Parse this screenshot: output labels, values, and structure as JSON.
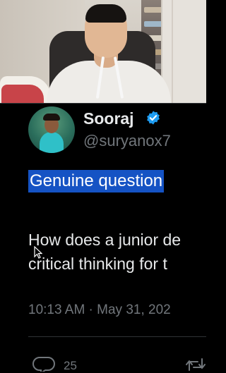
{
  "tweet": {
    "display_name": "Sooraj",
    "handle": "@suryanox7",
    "highlighted_text": "Genuine question",
    "body_line1": "How does a junior de",
    "body_line2": "critical thinking for t",
    "timestamp": "10:13 AM · May 31, 202",
    "reply_count": "25"
  },
  "icons": {
    "verified": "verified-badge-icon",
    "reply": "reply-icon",
    "retweet": "retweet-icon",
    "cursor": "mouse-cursor-icon"
  },
  "colors": {
    "background": "#000000",
    "text": "#e7e9ea",
    "muted": "#71767b",
    "verified": "#1d9bf0",
    "highlight": "#1553c4"
  }
}
